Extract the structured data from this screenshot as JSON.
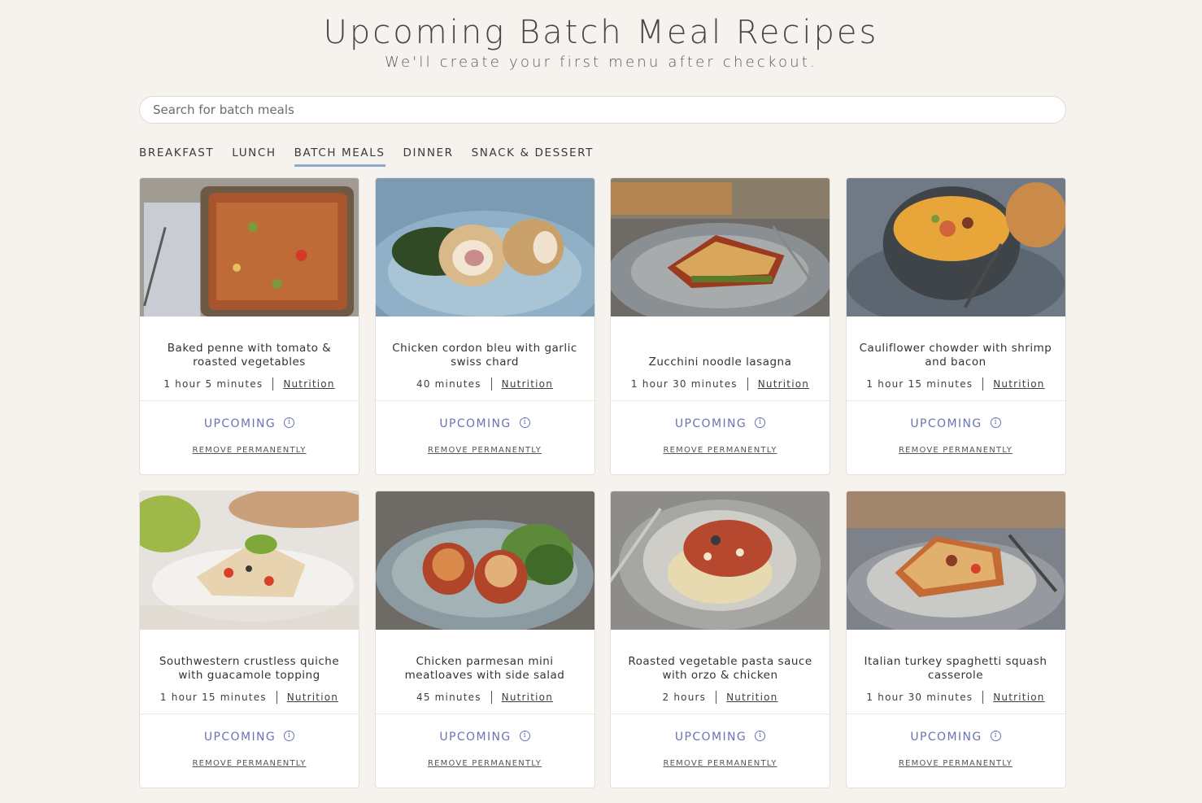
{
  "header": {
    "title": "Upcoming Batch Meal Recipes",
    "subtitle": "We'll create your first menu after checkout."
  },
  "search": {
    "placeholder": "Search for batch meals",
    "value": ""
  },
  "tabs": [
    {
      "label": "BREAKFAST",
      "active": false
    },
    {
      "label": "LUNCH",
      "active": false
    },
    {
      "label": "BATCH MEALS",
      "active": true
    },
    {
      "label": "DINNER",
      "active": false
    },
    {
      "label": "SNACK & DESSERT",
      "active": false
    }
  ],
  "accent_color": "#6a74b4",
  "tab_underline_color": "#8ea8cf",
  "recipes": [
    {
      "title": "Baked penne with tomato & roasted vegetables",
      "time": "1 hour 5 minutes",
      "nutrition": "Nutrition",
      "status": "UPCOMING",
      "remove": "REMOVE PERMANENTLY",
      "image": "baked-penne-photo"
    },
    {
      "title": "Chicken cordon bleu with garlic swiss chard",
      "time": "40 minutes",
      "nutrition": "Nutrition",
      "status": "UPCOMING",
      "remove": "REMOVE PERMANENTLY",
      "image": "chicken-cordon-bleu-photo"
    },
    {
      "title": "Zucchini noodle lasagna",
      "time": "1 hour 30 minutes",
      "nutrition": "Nutrition",
      "status": "UPCOMING",
      "remove": "REMOVE PERMANENTLY",
      "image": "zucchini-lasagna-photo"
    },
    {
      "title": "Cauliflower chowder with shrimp and bacon",
      "time": "1 hour 15 minutes",
      "nutrition": "Nutrition",
      "status": "UPCOMING",
      "remove": "REMOVE PERMANENTLY",
      "image": "cauliflower-chowder-photo"
    },
    {
      "title": "Southwestern crustless quiche with guacamole topping",
      "time": "1 hour 15 minutes",
      "nutrition": "Nutrition",
      "status": "UPCOMING",
      "remove": "REMOVE PERMANENTLY",
      "image": "quiche-photo"
    },
    {
      "title": "Chicken parmesan mini meatloaves with side salad",
      "time": "45 minutes",
      "nutrition": "Nutrition",
      "status": "UPCOMING",
      "remove": "REMOVE PERMANENTLY",
      "image": "meatloaves-photo"
    },
    {
      "title": "Roasted vegetable pasta sauce with orzo & chicken",
      "time": "2 hours",
      "nutrition": "Nutrition",
      "status": "UPCOMING",
      "remove": "REMOVE PERMANENTLY",
      "image": "pasta-sauce-photo"
    },
    {
      "title": "Italian turkey spaghetti squash casserole",
      "time": "1 hour 30 minutes",
      "nutrition": "Nutrition",
      "status": "UPCOMING",
      "remove": "REMOVE PERMANENTLY",
      "image": "squash-casserole-photo"
    }
  ]
}
